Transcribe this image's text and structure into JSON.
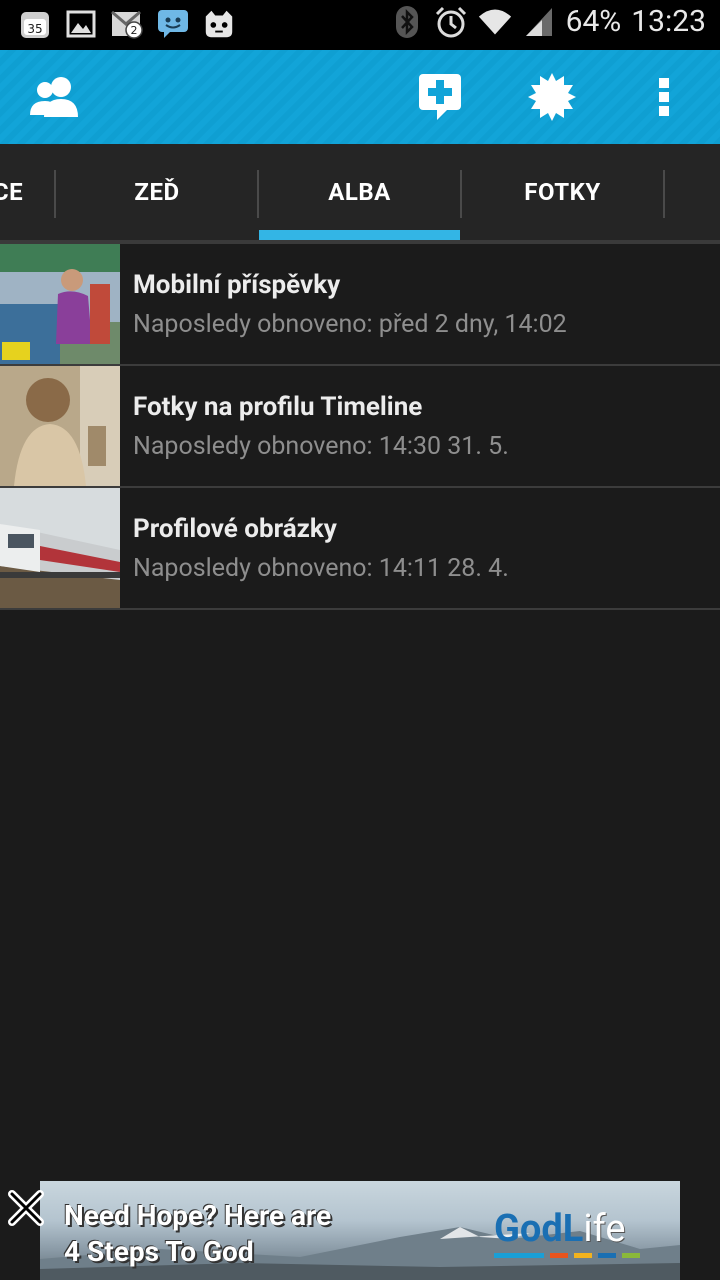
{
  "status_bar": {
    "notif_count_1": "35",
    "notif_count_2": "2",
    "battery": "64%",
    "time": "13:23",
    "icons": [
      "calendar-icon",
      "gallery-icon",
      "gmail-icon",
      "messenger-icon",
      "cyanogen-icon",
      "bluetooth-icon",
      "alarm-icon",
      "wifi-icon",
      "signal-icon"
    ]
  },
  "action_bar": {
    "color": "#12a4d8",
    "icons": [
      "friends-icon",
      "new-post-icon",
      "chat-status-icon",
      "overflow-menu-icon"
    ]
  },
  "tabs": [
    {
      "label": "CE"
    },
    {
      "label": "ZEĎ"
    },
    {
      "label": "ALBA",
      "selected": true
    },
    {
      "label": "FOTKY"
    }
  ],
  "albums": [
    {
      "title": "Mobilní příspěvky",
      "subtitle": "Naposledy obnoveno: před 2 dny, 14:02"
    },
    {
      "title": "Fotky na profilu Timeline",
      "subtitle": "Naposledy obnoveno: 14:30 31. 5."
    },
    {
      "title": "Profilové obrázky",
      "subtitle": "Naposledy obnoveno: 14:11 28. 4."
    }
  ],
  "ad": {
    "line1": "Need Hope? Here are",
    "line2": "4 Steps To God",
    "brand_bold": "GodL",
    "brand_light": "ife"
  },
  "accent_color": "#33b5e5"
}
